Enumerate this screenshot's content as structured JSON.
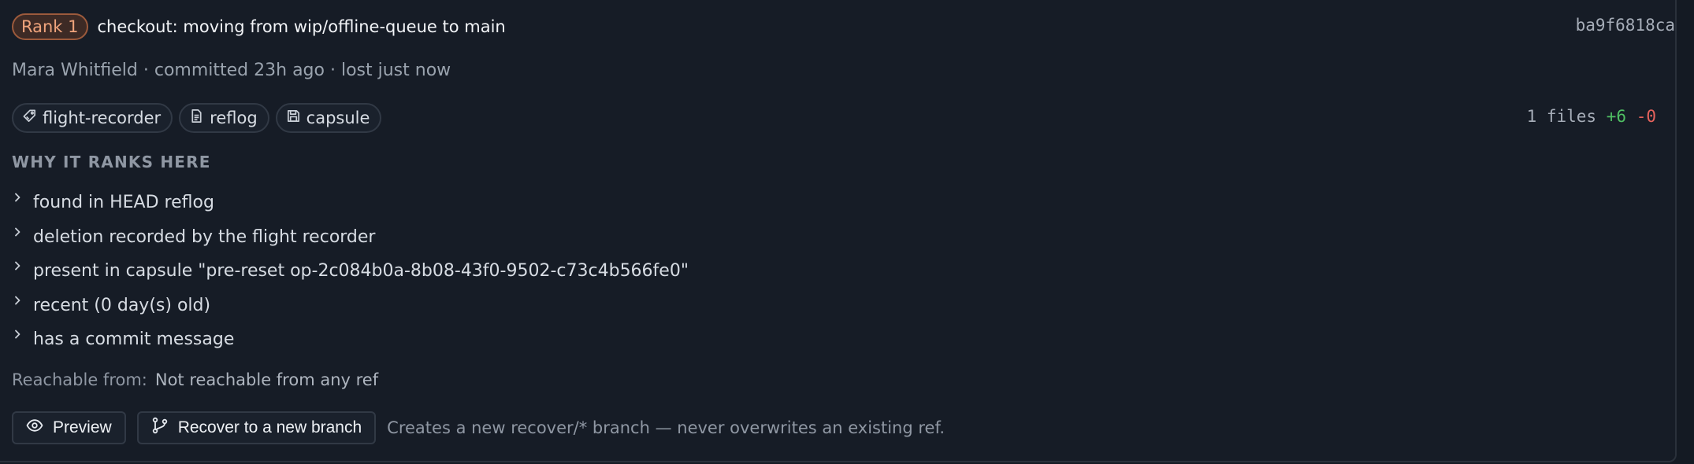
{
  "commit": {
    "rank_label": "Rank 1",
    "title": "checkout: moving from wip/offline-queue to main",
    "sha": "ba9f6818ca",
    "meta": "Mara Whitfield · committed 23h ago · lost just now"
  },
  "chips": [
    {
      "label": "flight-recorder",
      "icon": "tag-icon"
    },
    {
      "label": "reflog",
      "icon": "document-icon"
    },
    {
      "label": "capsule",
      "icon": "save-icon"
    }
  ],
  "stats": {
    "files": "1 files",
    "additions": "+6",
    "deletions": "-0"
  },
  "why": {
    "heading": "WHY IT RANKS HERE",
    "reasons": [
      "found in HEAD reflog",
      "deletion recorded by the flight recorder",
      "present in capsule \"pre-reset op-2c084b0a-8b08-43f0-9502-c73c4b566fe0\"",
      "recent (0 day(s) old)",
      "has a commit message"
    ]
  },
  "reachable": {
    "label": "Reachable from:",
    "value": "Not reachable from any ref"
  },
  "actions": {
    "preview_label": "Preview",
    "recover_label": "Recover to a new branch",
    "hint": "Creates a new recover/* branch — never overwrites an existing ref."
  },
  "colors": {
    "background": "#161c26",
    "rank_accent": "#f0a47c",
    "additions": "#4fbf63",
    "deletions": "#e5625c"
  }
}
